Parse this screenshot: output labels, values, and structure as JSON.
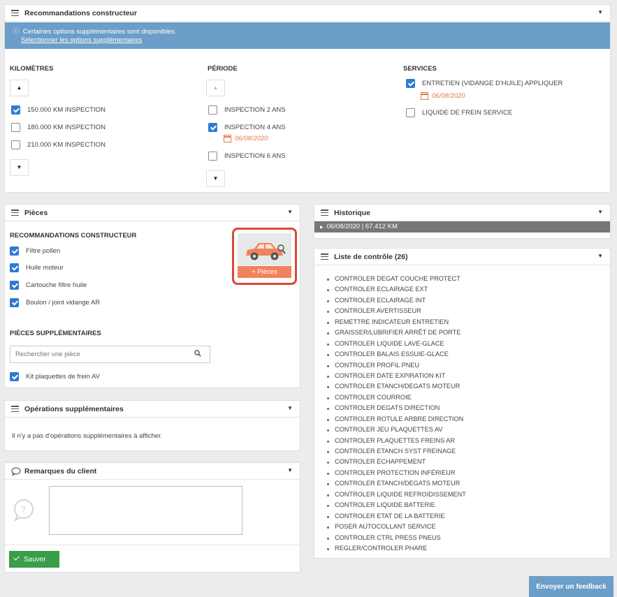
{
  "reco": {
    "title": "Recommandations constructeur",
    "info_text": "Certaines options supplémentaires sont disponibles.",
    "info_link": "Sélectionner les options supplémentaires",
    "km_header": "KILOMÈTRES",
    "km_items": [
      {
        "label": "150.000 KM INSPECTION",
        "checked": true
      },
      {
        "label": "180.000 KM INSPECTION",
        "checked": false
      },
      {
        "label": "210.000 KM INSPECTION",
        "checked": false
      }
    ],
    "period_header": "PÉRIODE",
    "period_items": [
      {
        "label": "INSPECTION 2 ANS",
        "checked": false
      },
      {
        "label": "INSPECTION 4 ANS",
        "checked": true,
        "date": "06/08/2020"
      },
      {
        "label": "INSPECTION 6 ANS",
        "checked": false
      }
    ],
    "services_header": "SERVICES",
    "services_items": [
      {
        "label": "ENTRETIEN (VIDANGE D'HUILE) APPLIQUER",
        "checked": true,
        "date": "06/08/2020"
      },
      {
        "label": "LIQUIDE DE FREIN SERVICE",
        "checked": false
      }
    ]
  },
  "pieces": {
    "title": "Pièces",
    "reco_header": "RECOMMANDATIONS CONSTRUCTEUR",
    "reco_items": [
      {
        "label": "Filtre pollen",
        "checked": true
      },
      {
        "label": "Huile moteur",
        "checked": true
      },
      {
        "label": "Cartouche filtre huile",
        "checked": true
      },
      {
        "label": "Boulon / joint vidange AR",
        "checked": true
      }
    ],
    "add_button": "+ Pièces",
    "extra_header": "PIÈCES SUPPLÉMENTAIRES",
    "search_placeholder": "Rechercher une pièce",
    "extra_items": [
      {
        "label": "Kit plaquettes de frein AV",
        "checked": true
      }
    ]
  },
  "operations": {
    "title": "Opérations supplémentaires",
    "empty_text": "Il n'y a pas d'opérations supplémentaires à afficher."
  },
  "remarks": {
    "title": "Remarques du client",
    "save_label": "Sauver"
  },
  "history": {
    "title": "Historique",
    "entry": "06/08/2020 | 67.412 KM"
  },
  "checklist": {
    "title": "Liste de contrôle (26)",
    "items": [
      "CONTROLER DEGAT COUCHE PROTECT",
      "CONTROLER ECLAIRAGE EXT",
      "CONTROLER ECLAIRAGE INT",
      "CONTROLER AVERTISSEUR",
      "REMETTRE INDICATEUR ENTRETIEN",
      "GRAISSER/LUBRIFIER ARRÊT DE PORTE",
      "CONTROLER LIQUIDE LAVE-GLACE",
      "CONTROLER BALAIS ESSUIE-GLACE",
      "CONTROLER PROFIL PNEU",
      "CONTROLER DATE EXPIRATION KIT",
      "CONTROLER ETANCH/DEGATS MOTEUR",
      "CONTROLER COURROIE",
      "CONTROLER DEGATS DIRECTION",
      "CONTROLER ROTULE ARBRE DIRECTION",
      "CONTROLER JEU PLAQUETTES AV",
      "CONTROLER PLAQUETTES FREINS AR",
      "CONTROLER ETANCH SYST FREINAGE",
      "CONTROLER ÉCHAPPEMENT",
      "CONTROLER PROTECTION INFÉRIEUR",
      "CONTROLER ETANCH/DEGATS MOTEUR",
      "CONTROLER LIQUIDE REFROIDISSEMENT",
      "CONTROLER LIQUIDE BATTERIE",
      "CONTROLER ETAT DE LA BATTERIE",
      "POSER AUTOCOLLANT SERVICE",
      "CONTROLER CTRL PRESS PNEUS",
      "REGLER/CONTROLER PHARE"
    ]
  },
  "feedback_label": "Envoyer un feedback",
  "colors": {
    "info_blue": "#6b9ec8",
    "checkbox_blue": "#2c7bd4",
    "date_orange": "#e6784b",
    "highlight_red": "#d94a34",
    "save_green": "#3a9d48"
  }
}
